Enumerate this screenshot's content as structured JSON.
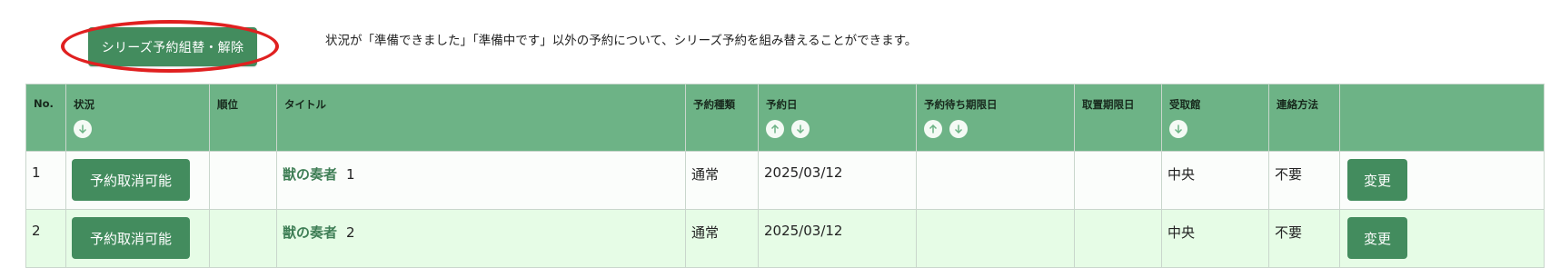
{
  "toolbar": {
    "series_button_label": "シリーズ予約組替・解除",
    "description": "状況が「準備できました」「準備中です」以外の予約について、シリーズ予約を組み替えることができます。"
  },
  "table": {
    "headers": {
      "no": "No.",
      "status": "状況",
      "rank": "順位",
      "title": "タイトル",
      "type": "予約種類",
      "date": "予約日",
      "wait_limit": "予約待ち期限日",
      "hold_limit": "取置期限日",
      "pickup": "受取館",
      "contact": "連絡方法"
    },
    "rows": [
      {
        "no": "1",
        "status": "予約取消可能",
        "rank": "",
        "title": "獣の奏者",
        "volume": "1",
        "type": "通常",
        "date": "2025/03/12",
        "wait_limit": "",
        "hold_limit": "",
        "pickup": "中央",
        "contact": "不要",
        "action": "変更"
      },
      {
        "no": "2",
        "status": "予約取消可能",
        "rank": "",
        "title": "獣の奏者",
        "volume": "2",
        "type": "通常",
        "date": "2025/03/12",
        "wait_limit": "",
        "hold_limit": "",
        "pickup": "中央",
        "contact": "不要",
        "action": "変更"
      }
    ]
  },
  "icons": {
    "sort_up": "arrow-up-circle-icon",
    "sort_down": "arrow-down-circle-icon"
  },
  "colors": {
    "accent": "#438c5e",
    "header_bg": "#6db386",
    "highlight_ring": "#e02020",
    "row_alt_bg": "#e6fce6"
  }
}
